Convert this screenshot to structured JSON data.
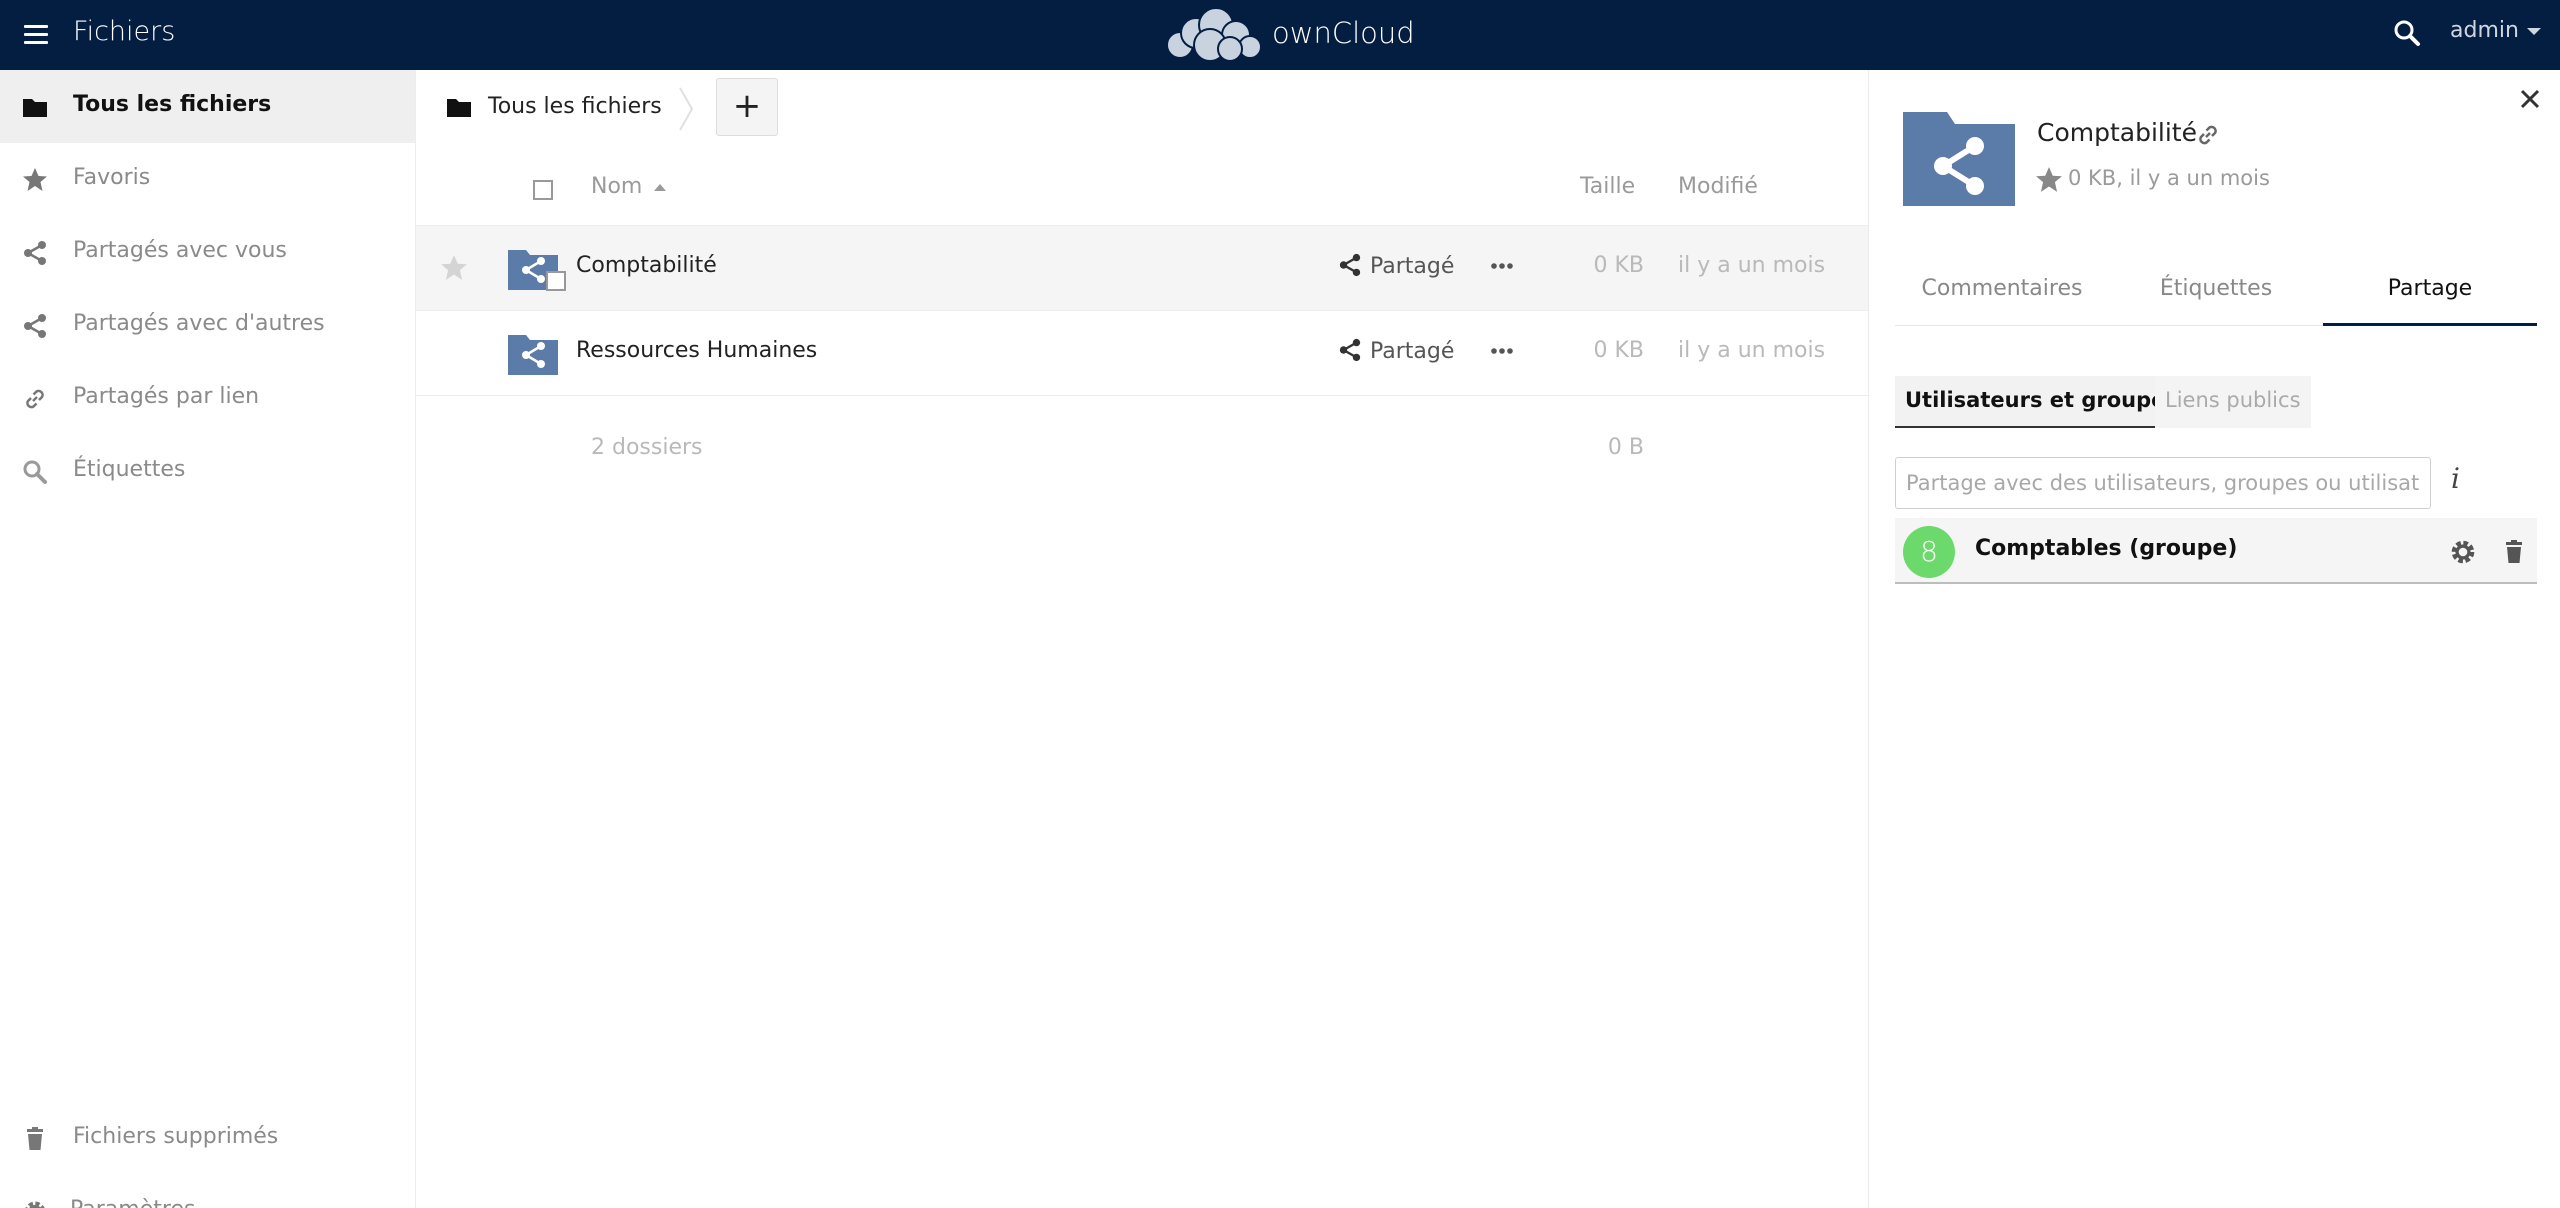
{
  "header": {
    "app_title": "Fichiers",
    "logo_text": "ownCloud",
    "user": "admin",
    "bg_color": "#041e42"
  },
  "sidebar": {
    "items": [
      {
        "label": "Tous les fichiers",
        "icon": "folder-icon",
        "active": true
      },
      {
        "label": "Favoris",
        "icon": "star-icon"
      },
      {
        "label": "Partagés avec vous",
        "icon": "share-icon"
      },
      {
        "label": "Partagés avec d'autres",
        "icon": "share-icon"
      },
      {
        "label": "Partagés par lien",
        "icon": "link-icon"
      },
      {
        "label": "Étiquettes",
        "icon": "search-icon"
      }
    ],
    "bottom": [
      {
        "label": "Fichiers supprimés",
        "icon": "trash-icon"
      },
      {
        "label": "Paramètres",
        "icon": "gear-icon"
      }
    ]
  },
  "breadcrumb": {
    "label": "Tous les fichiers",
    "new_label": "+"
  },
  "table": {
    "headers": {
      "name": "Nom",
      "size": "Taille",
      "modified": "Modifié"
    },
    "rows": [
      {
        "name": "Comptabilité",
        "share": "Partagé",
        "size": "0 KB",
        "modified": "il y a un mois",
        "selected": true
      },
      {
        "name": "Ressources Humaines",
        "share": "Partagé",
        "size": "0 KB",
        "modified": "il y a un mois",
        "selected": false
      }
    ],
    "summary": {
      "count": "2 dossiers",
      "size": "0 B"
    }
  },
  "details": {
    "title": "Comptabilité",
    "meta": "0 KB, il y a un mois",
    "tabs": [
      "Commentaires",
      "Étiquettes",
      "Partage"
    ],
    "active_tab": "Partage",
    "subtabs": [
      "Utilisateurs et groupes",
      "Liens publics"
    ],
    "share_placeholder": "Partage avec des utilisateurs, groupes ou utilisateurs",
    "info_glyph": "i",
    "sharee": {
      "avatar_letter": "8",
      "name": "Comptables (groupe)",
      "avatar_color": "#6bd96b"
    }
  },
  "colors": {
    "folder": "#5b7ba8",
    "accent": "#041e42"
  }
}
